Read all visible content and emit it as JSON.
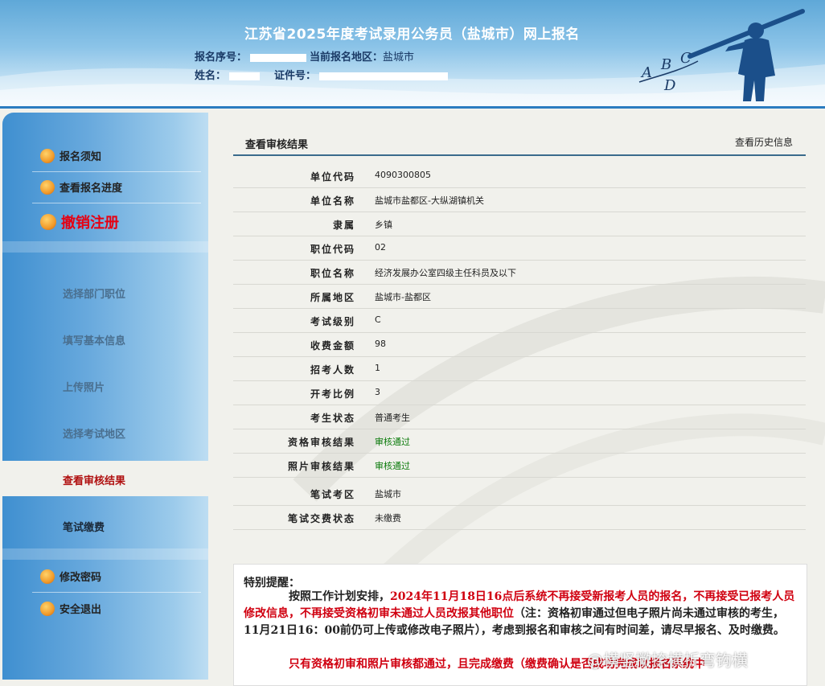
{
  "header": {
    "title": "江苏省2025年度考试录用公务员（盐城市）网上报名",
    "reg_no_label": "报名序号：",
    "region_label": "当前报名地区：",
    "region_value": "盐城市",
    "name_label": "姓名：",
    "id_label": "证件号：",
    "decor_letters": [
      "A",
      "B",
      "C",
      "D"
    ]
  },
  "sidebar": {
    "top_items": [
      {
        "label": "报名须知",
        "icon": "notice-icon"
      },
      {
        "label": "查看报名进度",
        "icon": "progress-icon"
      },
      {
        "label": "撤销注册",
        "icon": "cancel-icon"
      }
    ],
    "steps": [
      {
        "label": "选择部门职位"
      },
      {
        "label": "填写基本信息"
      },
      {
        "label": "上传照片"
      },
      {
        "label": "选择考试地区"
      },
      {
        "label": "查看审核结果",
        "active": true
      },
      {
        "label": "笔试缴费"
      }
    ],
    "bottom_items": [
      {
        "label": "修改密码",
        "icon": "password-icon"
      },
      {
        "label": "安全退出",
        "icon": "logout-icon"
      }
    ]
  },
  "main": {
    "section_title": "查看审核结果",
    "history_link": "查看历史信息",
    "rows": [
      {
        "label": "单位代码",
        "value": "4090300805"
      },
      {
        "label": "单位名称",
        "value": "盐城市盐都区-大纵湖镇机关"
      },
      {
        "label": "隶属",
        "value": "乡镇"
      },
      {
        "label": "职位代码",
        "value": "02"
      },
      {
        "label": "职位名称",
        "value": "经济发展办公室四级主任科员及以下"
      },
      {
        "label": "所属地区",
        "value": "盐城市-盐都区"
      },
      {
        "label": "考试级别",
        "value": "C"
      },
      {
        "label": "收费金额",
        "value": "98"
      },
      {
        "label": "招考人数",
        "value": "1"
      },
      {
        "label": "开考比例",
        "value": "3"
      },
      {
        "label": "考生状态",
        "value": "普通考生"
      },
      {
        "label": "资格审核结果",
        "value": "审核通过",
        "status": "pass"
      },
      {
        "label": "照片审核结果",
        "value": "审核通过",
        "status": "pass"
      },
      {
        "label": "笔试考区",
        "value": "盐城市"
      },
      {
        "label": "笔试交费状态",
        "value": "未缴费"
      }
    ],
    "notice": {
      "title": "特别提醒：",
      "p1_lead": "按照工作计划安排，",
      "p1_red": "2024年11月18日16点后系统不再接受新报考人员的报名，不再接受已报考人员修改信息，不再接受资格初审未通过人员改报其他职位",
      "p1_tail": "（注：资格初审通过但电子照片尚未通过审核的考生，11月21日16：00前仍可上传或修改电子照片），考虑到报名和审核之间有时间差，请尽早报名、及时缴费。",
      "p2_red": "只有资格初审和照片审核都通过，且完成缴费（缴费确认是否成功完成以报名系统中"
    }
  },
  "watermark": "@横竖撇捺横折弯钩横",
  "colors": {
    "accent": "#2b7cc0",
    "cancel": "#e60012",
    "active_step": "#b01010",
    "pass": "#0a7a0a",
    "notice_red": "#d00010"
  }
}
